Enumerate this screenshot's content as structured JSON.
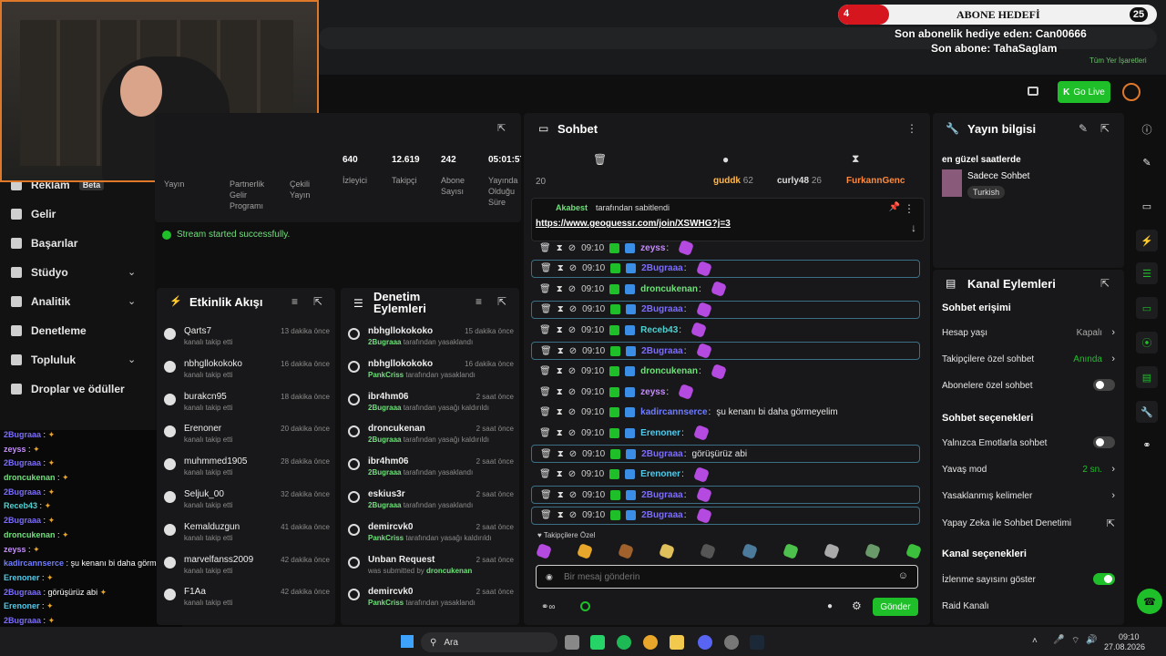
{
  "overlay": {
    "goal_current": "4",
    "goal_title": "ABONE HEDEFİ",
    "goal_target": "25",
    "goal_progress": 0.16,
    "last_gift": "Son abonelik hediye eden: Can00666",
    "last_sub": "Son abone: TahaSaglam"
  },
  "browser": {
    "bookmarks_label": "Tüm Yer İşaretleri"
  },
  "header": {
    "go_live": "Go Live"
  },
  "sidebar": {
    "items": [
      {
        "label": "Reklam",
        "badge": "Beta"
      },
      {
        "label": "Gelir"
      },
      {
        "label": "Başarılar"
      },
      {
        "label": "Stüdyo"
      },
      {
        "label": "Analitik"
      },
      {
        "label": "Denetleme"
      },
      {
        "label": "Topluluk"
      },
      {
        "label": "Droplar ve ödüller"
      }
    ]
  },
  "stats": {
    "labels": [
      "Yayın",
      "Partnerlik Gelir Programı",
      "Çekili Yayın"
    ],
    "items": [
      {
        "value": "640",
        "label": "İzleyici"
      },
      {
        "value": "12.619",
        "label": "Takipçi"
      },
      {
        "value": "242",
        "label": "Abone Sayısı"
      },
      {
        "value": "05:01:57",
        "label": "Yayında Olduğu Süre"
      }
    ],
    "success": "Stream started successfully."
  },
  "feed": {
    "title": "Etkinlik Akışı",
    "items": [
      {
        "name": "Qarts7",
        "sub": "kanalı takip etti",
        "time": "13 dakika önce"
      },
      {
        "name": "nbhgllokokoko",
        "sub": "kanalı takip etti",
        "time": "16 dakika önce"
      },
      {
        "name": "burakcn95",
        "sub": "kanalı takip etti",
        "time": "18 dakika önce"
      },
      {
        "name": "Erenoner",
        "sub": "kanalı takip etti",
        "time": "20 dakika önce"
      },
      {
        "name": "muhmmed1905",
        "sub": "kanalı takip etti",
        "time": "28 dakika önce"
      },
      {
        "name": "Seljuk_00",
        "sub": "kanalı takip etti",
        "time": "32 dakika önce"
      },
      {
        "name": "Kemalduzgun",
        "sub": "kanalı takip etti",
        "time": "41 dakika önce"
      },
      {
        "name": "marvelfanss2009",
        "sub": "kanalı takip etti",
        "time": "42 dakika önce"
      },
      {
        "name": "F1Aa",
        "sub": "kanalı takip etti",
        "time": "42 dakika önce"
      }
    ]
  },
  "mod": {
    "title1": "Denetim",
    "title2": "Eylemleri",
    "items": [
      {
        "name": "nbhgllokokoko",
        "actor": "2Bugraaa",
        "sub": " tarafından yasaklandı",
        "time": "15 dakika önce"
      },
      {
        "name": "nbhgllokokoko",
        "actor": "PankCriss",
        "sub": " tarafından yasaklandı",
        "time": "16 dakika önce"
      },
      {
        "name": "ibr4hm06",
        "actor": "2Bugraaa",
        "sub": " tarafından yasağı kaldırıldı",
        "time": "2 saat önce"
      },
      {
        "name": "droncukenan",
        "actor": "2Bugraaa",
        "sub": " tarafından yasağı kaldırıldı",
        "time": "2 saat önce"
      },
      {
        "name": "ibr4hm06",
        "actor": "2Bugraaa",
        "sub": " tarafından yasaklandı",
        "time": "2 saat önce"
      },
      {
        "name": "eskius3r",
        "actor": "2Bugraaa",
        "sub": " tarafından yasaklandı",
        "time": "2 saat önce"
      },
      {
        "name": "demircvk0",
        "actor": "PankCriss",
        "sub": " tarafından yasağı kaldırıldı",
        "time": "2 saat önce"
      },
      {
        "name": "Unban Request",
        "actor": "droncukenan",
        "sub": "was submitted by ",
        "time": "2 saat önce"
      },
      {
        "name": "demircvk0",
        "actor": "PankCriss",
        "sub": " tarafından yasaklandı",
        "time": "2 saat önce"
      }
    ]
  },
  "chat": {
    "title": "Sohbet",
    "viewer_count": "20",
    "leaders": [
      {
        "name": "guddk",
        "n": "62"
      },
      {
        "name": "curly48",
        "n": "26"
      },
      {
        "name": "FurkannGenc",
        "n": ""
      }
    ],
    "pinned_by": "Akabest",
    "pinned_suffix": "tarafından sabitlendi",
    "pinned_link": "https://www.geoguessr.com/join/XSWHG?j=3",
    "messages": [
      {
        "time": "09:10",
        "user": "zeyss",
        "color": "#c68cff",
        "text": "",
        "hl": false
      },
      {
        "time": "09:10",
        "user": "2Bugraaa",
        "color": "#7b6cff",
        "text": "",
        "hl": true
      },
      {
        "time": "09:10",
        "user": "droncukenan",
        "color": "#6fe07a",
        "text": "",
        "hl": false
      },
      {
        "time": "09:10",
        "user": "2Bugraaa",
        "color": "#7b6cff",
        "text": "",
        "hl": true
      },
      {
        "time": "09:10",
        "user": "Receb43",
        "color": "#4fd1d1",
        "text": "",
        "hl": false
      },
      {
        "time": "09:10",
        "user": "2Bugraaa",
        "color": "#7b6cff",
        "text": "",
        "hl": true
      },
      {
        "time": "09:10",
        "user": "droncukenan",
        "color": "#6fe07a",
        "text": "",
        "hl": false
      },
      {
        "time": "09:10",
        "user": "zeyss",
        "color": "#c68cff",
        "text": "",
        "hl": false
      },
      {
        "time": "09:10",
        "user": "kadircannserce",
        "color": "#6f7cff",
        "text": " şu kenanı bi daha görmeyelim",
        "hl": false
      },
      {
        "time": "09:10",
        "user": "Erenoner",
        "color": "#52c9e8",
        "text": "",
        "hl": false
      },
      {
        "time": "09:10",
        "user": "2Bugraaa",
        "color": "#7b6cff",
        "text": " görüşürüz abi",
        "hl": true
      },
      {
        "time": "09:10",
        "user": "Erenoner",
        "color": "#52c9e8",
        "text": "",
        "hl": false
      },
      {
        "time": "09:10",
        "user": "2Bugraaa",
        "color": "#7b6cff",
        "text": "",
        "hl": true
      },
      {
        "time": "09:10",
        "user": "2Bugraaa",
        "color": "#7b6cff",
        "text": "",
        "hl": true
      }
    ],
    "followers_only": "Takipçilere Özel",
    "placeholder": "Bir mesaj gönderin",
    "send": "Gönder"
  },
  "info": {
    "title": "Yayın bilgisi",
    "stream_title": "en güzel saatlerde",
    "category": "Sadece Sohbet",
    "tag": "Turkish"
  },
  "actions": {
    "title": "Kanal Eylemleri",
    "s1": "Sohbet erişimi",
    "hesap": "Hesap yaşı",
    "hesap_val": "Kapalı",
    "takip": "Takipçilere özel sohbet",
    "takip_val": "Anında",
    "abone": "Abonelere özel sohbet",
    "s2": "Sohbet seçenekleri",
    "emote": "Yalnızca Emotlarla sohbet",
    "yavas": "Yavaş mod",
    "yavas_val": "2 sn.",
    "yasak": "Yasaklanmış kelimeler",
    "yz": "Yapay Zeka ile Sohbet Denetimi",
    "s3": "Kanal seçenekleri",
    "izlenme": "İzlenme sayısını göster",
    "raid": "Raid Kanalı"
  },
  "overlay_chat": [
    {
      "user": "2Bugraaa",
      "color": "#7b6cff",
      "text": " :"
    },
    {
      "user": "zeyss",
      "color": "#c68cff",
      "text": " :"
    },
    {
      "user": "2Bugraaa",
      "color": "#7b6cff",
      "text": " :"
    },
    {
      "user": "droncukenan",
      "color": "#6fe07a",
      "text": " :"
    },
    {
      "user": "2Bugraaa",
      "color": "#7b6cff",
      "text": " :"
    },
    {
      "user": "Receb43",
      "color": "#4fd1d1",
      "text": " :"
    },
    {
      "user": "2Bugraaa",
      "color": "#7b6cff",
      "text": " :"
    },
    {
      "user": "droncukenan",
      "color": "#6fe07a",
      "text": " :"
    },
    {
      "user": "zeyss",
      "color": "#c68cff",
      "text": " :"
    },
    {
      "user": "kadircannserce",
      "color": "#6f7cff",
      "text": " : şu kenanı bi daha görmeyelim"
    },
    {
      "user": "Erenoner",
      "color": "#52c9e8",
      "text": " :"
    },
    {
      "user": "2Bugraaa",
      "color": "#7b6cff",
      "text": " : görüşürüz abi"
    },
    {
      "user": "Erenoner",
      "color": "#52c9e8",
      "text": " :"
    },
    {
      "user": "2Bugraaa",
      "color": "#7b6cff",
      "text": " :"
    },
    {
      "user": "2Bugraaa",
      "color": "#7b6cff",
      "text": " :"
    }
  ],
  "taskbar": {
    "search": "Ara",
    "time": "09:10",
    "date": "27.08.2026"
  }
}
